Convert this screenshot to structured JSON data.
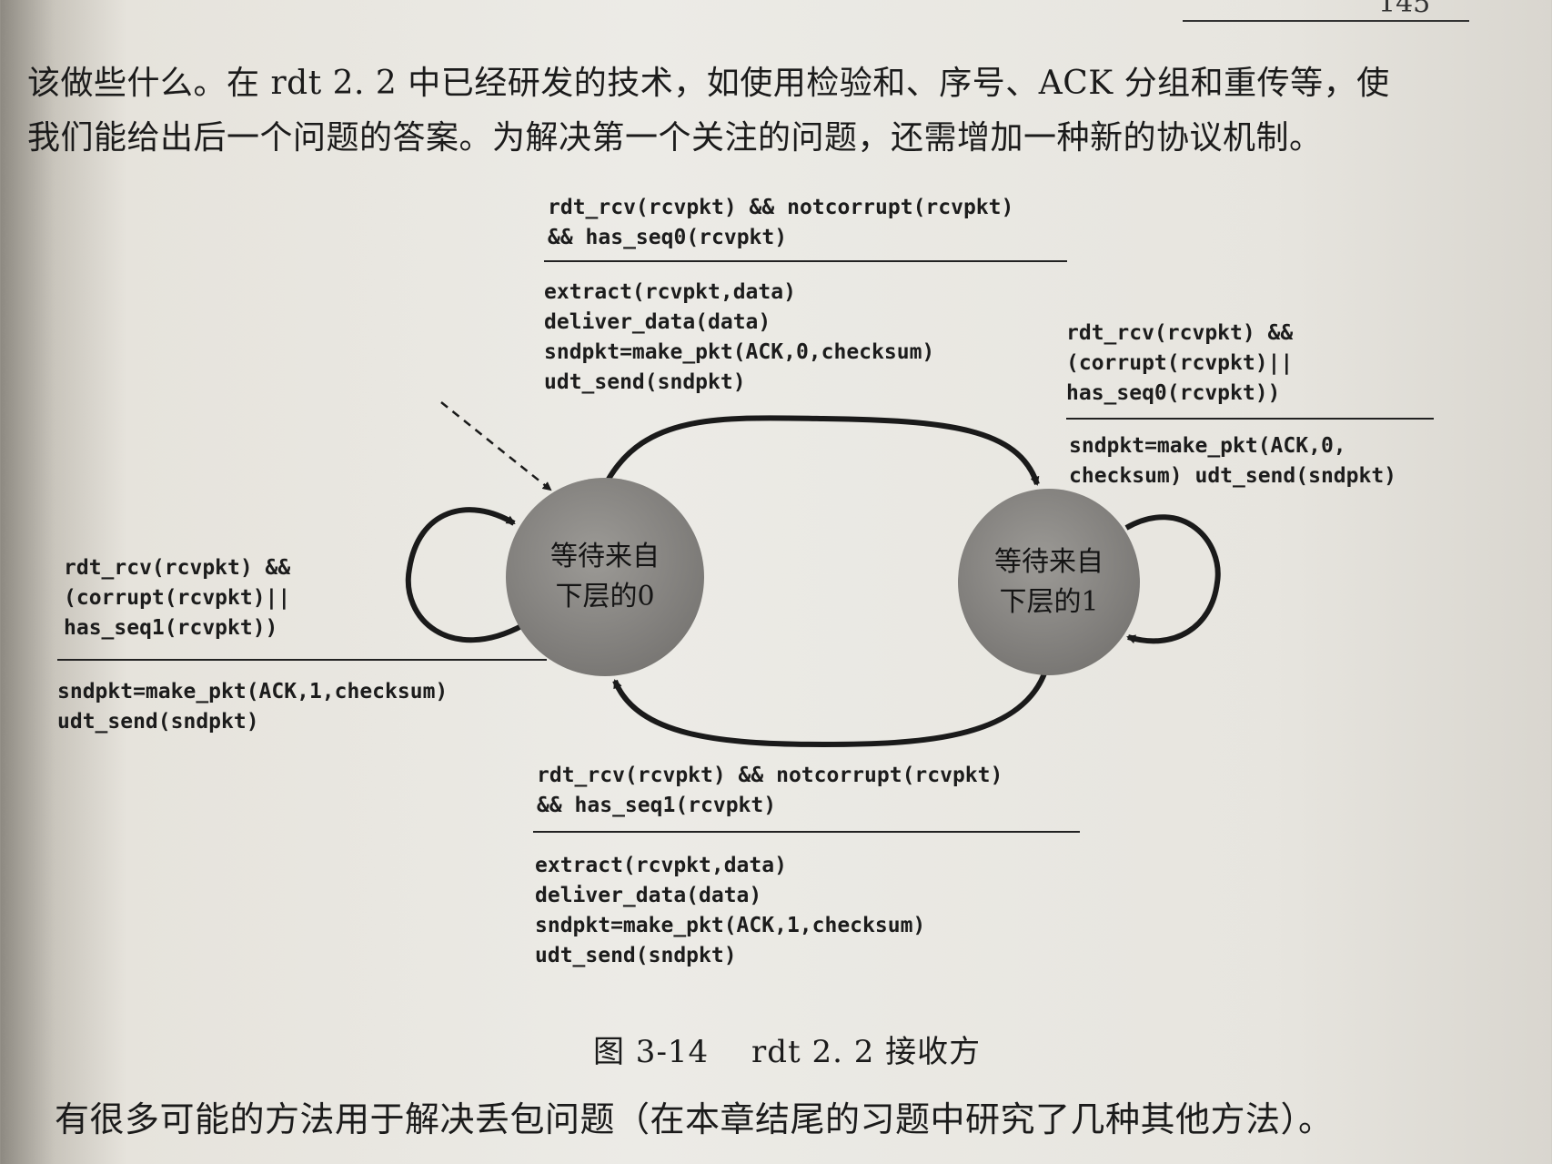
{
  "page": {
    "page_number": "145",
    "paragraph_top": {
      "line1": "该做些什么。在 rdt 2. 2 中已经研发的技术，如使用检验和、序号、ACK 分组和重传等，使",
      "line2": "我们能给出后一个问题的答案。为解决第一个关注的问题，还需增加一种新的协议机制。"
    },
    "paragraph_bottom": "有很多可能的方法用于解决丢包问题（在本章结尾的习题中研究了几种其他方法）。"
  },
  "diagram": {
    "states": [
      {
        "line1": "等待来自",
        "line2": "下层的0"
      },
      {
        "line1": "等待来自",
        "line2": "下层的1"
      }
    ],
    "transitions": {
      "top": {
        "event": [
          "rdt_rcv(rcvpkt) && notcorrupt(rcvpkt)",
          "&& has_seq0(rcvpkt)"
        ],
        "action": [
          "extract(rcvpkt,data)",
          "deliver_data(data)",
          "sndpkt=make_pkt(ACK,0,checksum)",
          "udt_send(sndpkt)"
        ]
      },
      "right_self": {
        "event": [
          "rdt_rcv(rcvpkt) &&",
          "(corrupt(rcvpkt)||",
          "has_seq0(rcvpkt))"
        ],
        "action": [
          "sndpkt=make_pkt(ACK,0,",
          "checksum) udt_send(sndpkt)"
        ]
      },
      "left_self": {
        "event": [
          "rdt_rcv(rcvpkt) &&",
          "(corrupt(rcvpkt)||",
          "has_seq1(rcvpkt))"
        ],
        "action": [
          "sndpkt=make_pkt(ACK,1,checksum)",
          "udt_send(sndpkt)"
        ]
      },
      "bottom": {
        "event": [
          "rdt_rcv(rcvpkt) && notcorrupt(rcvpkt)",
          "&& has_seq1(rcvpkt)"
        ],
        "action": [
          "extract(rcvpkt,data)",
          "deliver_data(data)",
          "sndpkt=make_pkt(ACK,1,checksum)",
          "udt_send(sndpkt)"
        ]
      }
    },
    "caption": "图 3-14　 rdt 2. 2 接收方"
  }
}
